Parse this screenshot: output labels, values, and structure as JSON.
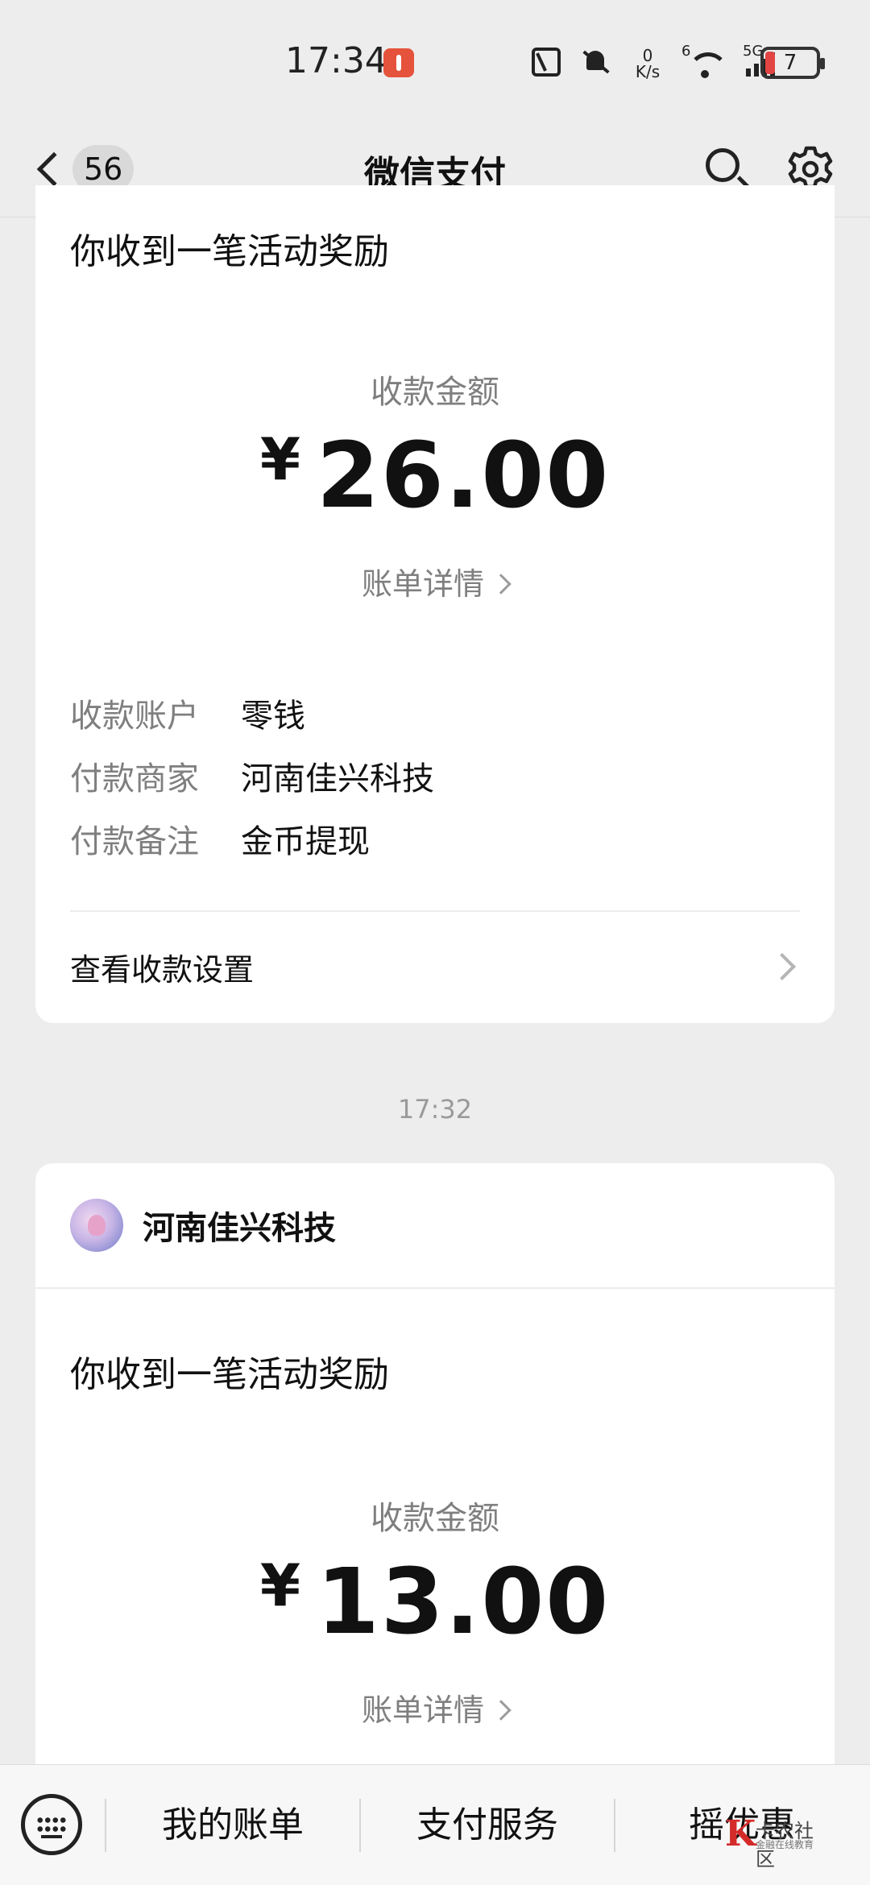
{
  "status_bar": {
    "time": "17:34",
    "net_speed_value": "0",
    "net_speed_unit": "K/s",
    "wifi_label": "6",
    "network_type": "5G",
    "battery_level": "7"
  },
  "nav": {
    "unread_count": "56",
    "title": "微信支付"
  },
  "messages": [
    {
      "title": "你收到一笔活动奖励",
      "amount_label": "收款金额",
      "currency": "¥",
      "amount": "26.00",
      "bill_link": "账单详情",
      "details": [
        {
          "key": "收款账户",
          "value": "零钱"
        },
        {
          "key": "付款商家",
          "value": "河南佳兴科技"
        },
        {
          "key": "付款备注",
          "value": "金币提现"
        }
      ],
      "settings_link": "查看收款设置"
    },
    {
      "timestamp": "17:32",
      "merchant": "河南佳兴科技",
      "title": "你收到一笔活动奖励",
      "amount_label": "收款金额",
      "currency": "¥",
      "amount": "13.00",
      "bill_link": "账单详情"
    }
  ],
  "bottom_menu": {
    "items": [
      "我的账单",
      "支付服务",
      "摇优惠"
    ]
  },
  "watermark": {
    "letter": "K",
    "title": "卡农社区",
    "subtitle": "金融在线教育"
  },
  "colors": {
    "background": "#ededed",
    "card": "#ffffff",
    "muted_text": "#7f7f7f",
    "battery_low": "#e24444"
  }
}
